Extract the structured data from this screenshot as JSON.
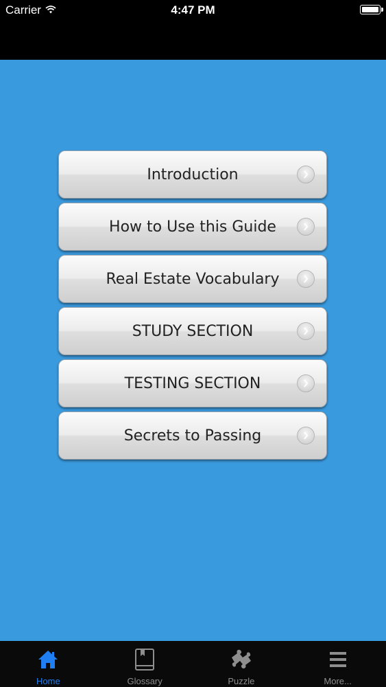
{
  "status_bar": {
    "carrier": "Carrier",
    "time": "4:47 PM",
    "battery_level": 1.0
  },
  "menu": {
    "items": [
      {
        "label": "Introduction",
        "icon": "chevron-right-icon"
      },
      {
        "label": "How to Use this Guide",
        "icon": "chevron-right-icon"
      },
      {
        "label": "Real Estate Vocabulary",
        "icon": "chevron-right-icon"
      },
      {
        "label": "STUDY SECTION",
        "icon": "chevron-right-icon"
      },
      {
        "label": "TESTING SECTION",
        "icon": "chevron-right-icon"
      },
      {
        "label": "Secrets to Passing",
        "icon": "chevron-right-icon"
      }
    ]
  },
  "tab_bar": {
    "tabs": [
      {
        "label": "Home",
        "icon": "home-icon",
        "active": true
      },
      {
        "label": "Glossary",
        "icon": "book-icon",
        "active": false
      },
      {
        "label": "Puzzle",
        "icon": "puzzle-icon",
        "active": false
      },
      {
        "label": "More...",
        "icon": "menu-icon",
        "active": false
      }
    ]
  },
  "colors": {
    "background": "#3a9ade",
    "active_tab": "#1f7ff2",
    "inactive_tab": "#8e8e8e"
  }
}
